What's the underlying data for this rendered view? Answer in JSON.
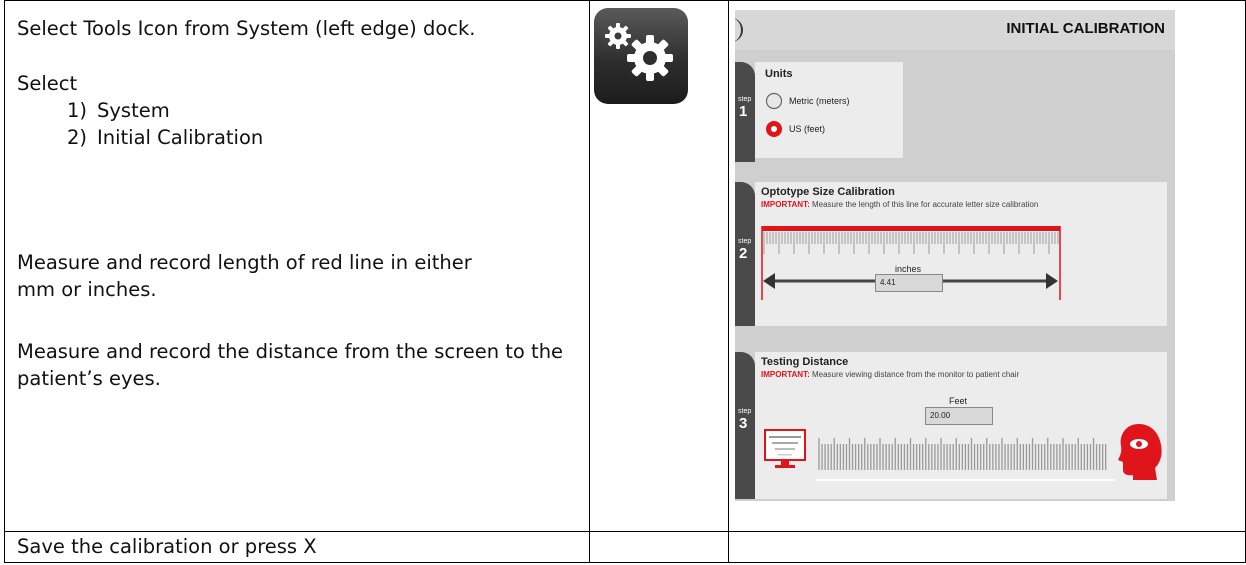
{
  "instructions": {
    "step1": "Select Tools Icon from System (left edge) dock.",
    "select_label": "Select",
    "list": [
      {
        "num": "1)",
        "text": "System"
      },
      {
        "num": "2)",
        "text": "Initial Calibration"
      }
    ],
    "measure_line": "Measure and record length of red line in either mm or inches.",
    "measure_distance": "Measure and record the distance from the screen to the patient’s eyes.",
    "save": "Save the calibration or press X"
  },
  "icon": {
    "name": "gears-icon"
  },
  "screenshot": {
    "title": "INITIAL CALIBRATION",
    "step_word": "step",
    "units": {
      "step": "1",
      "title": "Units",
      "options": [
        {
          "label": "Metric (meters)",
          "selected": false
        },
        {
          "label": "US (feet)",
          "selected": true
        }
      ]
    },
    "optotype": {
      "step": "2",
      "title": "Optotype Size Calibration",
      "important_label": "IMPORTANT:",
      "important_text": "Measure the length of this line for accurate letter size calibration",
      "unit_label": "inches",
      "value": "4.41"
    },
    "distance": {
      "step": "3",
      "title": "Testing Distance",
      "important_label": "IMPORTANT:",
      "important_text": "Measure viewing distance from the monitor to patient chair",
      "unit_label": "Feet",
      "value": "20.00"
    }
  },
  "colors": {
    "accent_red": "#e0141b",
    "tab_dark": "#4a4a4a",
    "panel": "#ececec",
    "background": "#cfcfcf"
  }
}
